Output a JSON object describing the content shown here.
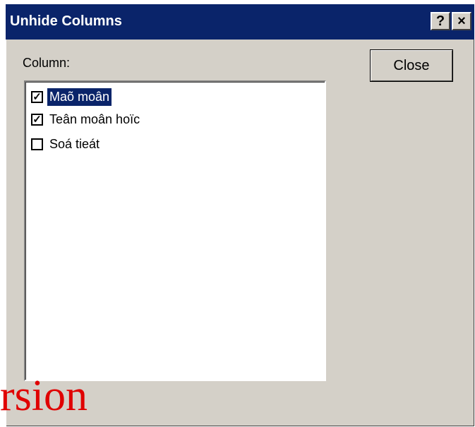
{
  "dialog": {
    "title": "Unhide Columns",
    "help_label": "?",
    "close_x_label": "×",
    "column_label": "Column:",
    "close_button_label": "Close",
    "items": [
      {
        "label": "Maõ moân",
        "checked": true,
        "selected": true,
        "check": "✓"
      },
      {
        "label": "Teân moân hoïc",
        "checked": true,
        "selected": false,
        "check": "✓"
      },
      {
        "label": "Soá tieát",
        "checked": false,
        "selected": false,
        "check": ""
      }
    ]
  },
  "overlay_text": "rsion",
  "colors": {
    "titlebar": "#0a246a",
    "dialog_bg": "#d4d0c8",
    "overlay": "#e00000"
  }
}
